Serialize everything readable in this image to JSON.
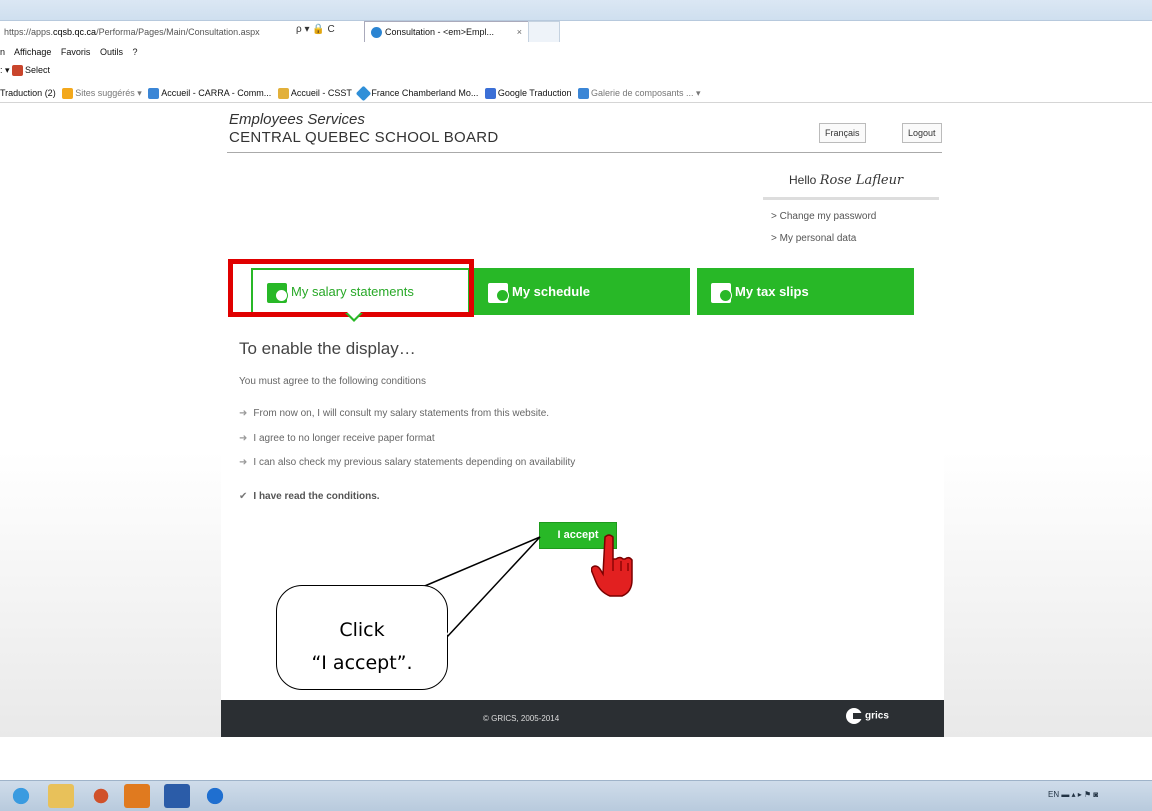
{
  "browser": {
    "address_prefix": "https://apps.",
    "address_domain": "cqsb.qc.ca",
    "address_path": "/Performa/Pages/Main/Consultation.aspx",
    "address_tools": "ρ ▾ 🔒 C",
    "tab_title": "Consultation - <em>Empl...",
    "tab_close": "×",
    "menu": [
      "n",
      "Affichage",
      "Favoris",
      "Outils",
      "?"
    ],
    "cmd": ": ▾",
    "cmd_select": "Select",
    "favorites": [
      "Traduction (2)",
      "Sites suggérés ▾",
      "Accueil - CARRA - Comm...",
      "Accueil - CSST",
      "France Chamberland Mo...",
      "Google Traduction",
      "Galerie de composants ... ▾"
    ]
  },
  "header": {
    "brand_line1": "Employees Services",
    "brand_line2": "CENTRAL QUEBEC SCHOOL BOARD",
    "lang_button": "Français",
    "logout_button": "Logout"
  },
  "user": {
    "hello": "Hello",
    "name": "Rose Lafleur",
    "links": [
      "> Change my password",
      "> My personal data"
    ]
  },
  "cards": [
    "My salary statements",
    "My schedule",
    "My tax slips"
  ],
  "main": {
    "heading": "To enable the display…",
    "intro": "You must agree to the following conditions",
    "conditions": [
      "From now on, I will consult my salary statements from this website.",
      "I agree to no longer receive paper format",
      "I can also check my previous salary statements depending on availability"
    ],
    "read": "I have read the conditions.",
    "accept_button": "I accept"
  },
  "footer": {
    "copyright": "© GRICS, 2005-2014",
    "logo": "grics"
  },
  "callout": {
    "line1": "Click",
    "line2": "“I accept”."
  },
  "taskbar": {
    "tray": "EN ▬ ▴ ▸ ⚑ ◙"
  },
  "colors": {
    "green": "#28b827",
    "highlight_red": "#e00000",
    "footer_bg": "#2b2f33"
  }
}
